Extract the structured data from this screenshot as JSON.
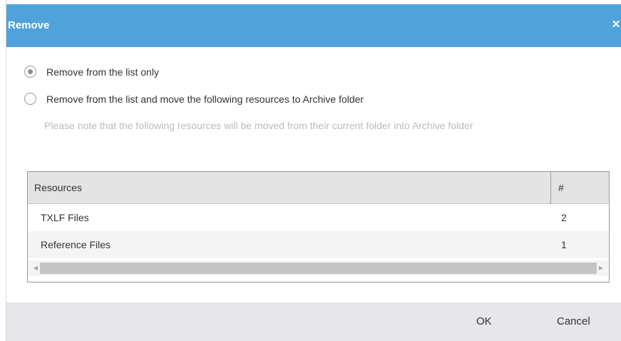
{
  "dialog": {
    "title": "Remove",
    "close_icon": "×"
  },
  "options": [
    {
      "label": "Remove from the list only",
      "selected": true
    },
    {
      "label": "Remove from the list and move the following resources to Archive folder",
      "selected": false
    }
  ],
  "note": "Please note that the following resources will be moved from their current folder into Archive folder",
  "table": {
    "columns": [
      "Resources",
      "#"
    ],
    "rows": [
      {
        "name": "TXLF Files",
        "count": "2"
      },
      {
        "name": "Reference Files",
        "count": "1"
      }
    ]
  },
  "scrollbar": {
    "left_arrow": "◀",
    "right_arrow": "▶"
  },
  "footer": {
    "ok_label": "OK",
    "cancel_label": "Cancel"
  },
  "colors": {
    "titlebar": "#4fa3da",
    "footer": "#e7e7eb",
    "table_header": "#e4e4e4",
    "note_text": "#bcbcbc"
  }
}
